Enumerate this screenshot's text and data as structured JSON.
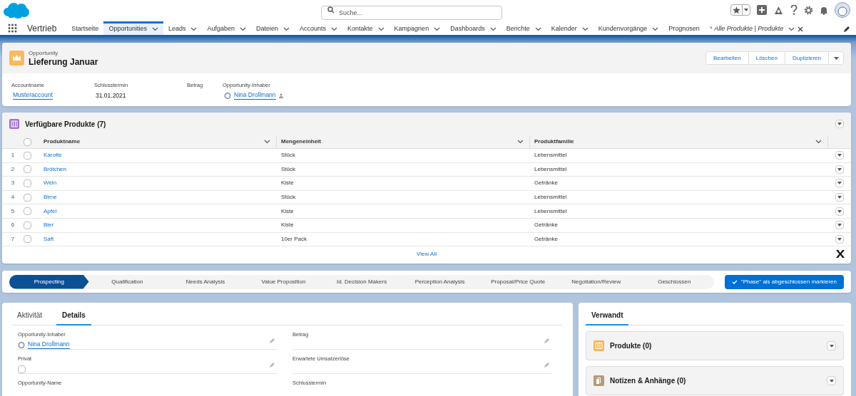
{
  "header": {
    "search": {
      "placeholder": "Suche..."
    }
  },
  "app_name": "Vertrieb",
  "nav_tabs": [
    {
      "label": "Startseite",
      "selected": false,
      "has_menu": false
    },
    {
      "label": "Opportunities",
      "selected": true,
      "has_menu": true
    },
    {
      "label": "Leads",
      "selected": false,
      "has_menu": true
    },
    {
      "label": "Aufgaben",
      "selected": false,
      "has_menu": true
    },
    {
      "label": "Dateien",
      "selected": false,
      "has_menu": true
    },
    {
      "label": "Accounts",
      "selected": false,
      "has_menu": true
    },
    {
      "label": "Kontakte",
      "selected": false,
      "has_menu": true
    },
    {
      "label": "Kampagnen",
      "selected": false,
      "has_menu": true
    },
    {
      "label": "Dashboards",
      "selected": false,
      "has_menu": true
    },
    {
      "label": "Berichte",
      "selected": false,
      "has_menu": true
    },
    {
      "label": "Kalender",
      "selected": false,
      "has_menu": true
    },
    {
      "label": "Kundenvorgänge",
      "selected": false,
      "has_menu": true
    },
    {
      "label": "Prognosen",
      "selected": false,
      "has_menu": false
    },
    {
      "label": "Alle Produkte | Produkte",
      "selected": false,
      "has_menu": true,
      "prefix": "*",
      "closable": true,
      "kind": "workspace"
    }
  ],
  "record": {
    "object_type": "Opportunity",
    "title": "Lieferung Januar",
    "buttons": [
      "Bearbeiten",
      "Löschen",
      "Duplizieren"
    ],
    "fields": [
      {
        "label": "Accountname",
        "value": "Musteraccount",
        "kind": "link"
      },
      {
        "label": "Schlusstermin",
        "value": "31.01.2021",
        "kind": "text"
      },
      {
        "label": "Betrag"
      },
      {
        "label": "Opportunity-Inhaber",
        "value": "Nina Drollmann",
        "kind": "user"
      }
    ]
  },
  "related_list": {
    "title": "Verfügbare Produkte (7)",
    "all_checked": false,
    "columns": [
      "Produktname",
      "Mengeneinheit",
      "Produktfamilie"
    ],
    "rows": [
      {
        "number": "1",
        "checked": false,
        "name": "Karotte",
        "unit": "Stück",
        "family": "Lebensmittel"
      },
      {
        "number": "2",
        "checked": false,
        "name": "Brötchen",
        "unit": "Stück",
        "family": "Lebensmittel"
      },
      {
        "number": "3",
        "checked": false,
        "name": "Wein",
        "unit": "Kiste",
        "family": "Getränke"
      },
      {
        "number": "4",
        "checked": false,
        "name": "Birne",
        "unit": "Stück",
        "family": "Lebensmittel"
      },
      {
        "number": "5",
        "checked": false,
        "name": "Apfel",
        "unit": "Kiste",
        "family": "Lebensmittel"
      },
      {
        "number": "6",
        "checked": false,
        "name": "Bier",
        "unit": "Kiste",
        "family": "Getränke"
      },
      {
        "number": "7",
        "checked": false,
        "name": "Saft",
        "unit": "10er Pack",
        "family": "Getränke"
      }
    ],
    "view_all": "View All"
  },
  "path": {
    "stages": [
      {
        "label": "Prospecting",
        "selected": true
      },
      {
        "label": "Qualification",
        "selected": false
      },
      {
        "label": "Needs Analysis",
        "selected": false
      },
      {
        "label": "Value Proposition",
        "selected": false
      },
      {
        "label": "Id. Decision Makers",
        "selected": false
      },
      {
        "label": "Perception Analysis",
        "selected": false
      },
      {
        "label": "Proposal/Price Quote",
        "selected": false
      },
      {
        "label": "Negotiation/Review",
        "selected": false
      },
      {
        "label": "Geschlossen",
        "selected": false
      }
    ],
    "button": "\"Phase\" als abgeschlossen markieren"
  },
  "detail_tabs": [
    {
      "label": "Aktivität",
      "selected": false
    },
    {
      "label": "Details",
      "selected": true
    }
  ],
  "details": [
    {
      "label": "Opportunity-Inhaber",
      "value": "Nina Drollmann",
      "kind": "user"
    },
    {
      "label": "Betrag"
    },
    {
      "label": "Privat",
      "kind": "checkbox",
      "checked": false
    },
    {
      "label": "Erwartete Umsatzerlöse"
    },
    {
      "label": "Opportunity-Name"
    },
    {
      "label": "Schlusstermin"
    }
  ],
  "related_tabs": [
    {
      "label": "Verwandt",
      "selected": true
    }
  ],
  "related_cards": [
    {
      "title": "Produkte (0)",
      "color": "#f8b653",
      "kind": "products"
    },
    {
      "title": "Notizen & Anhänge (0)",
      "color": "#b59b77",
      "kind": "notes"
    }
  ]
}
